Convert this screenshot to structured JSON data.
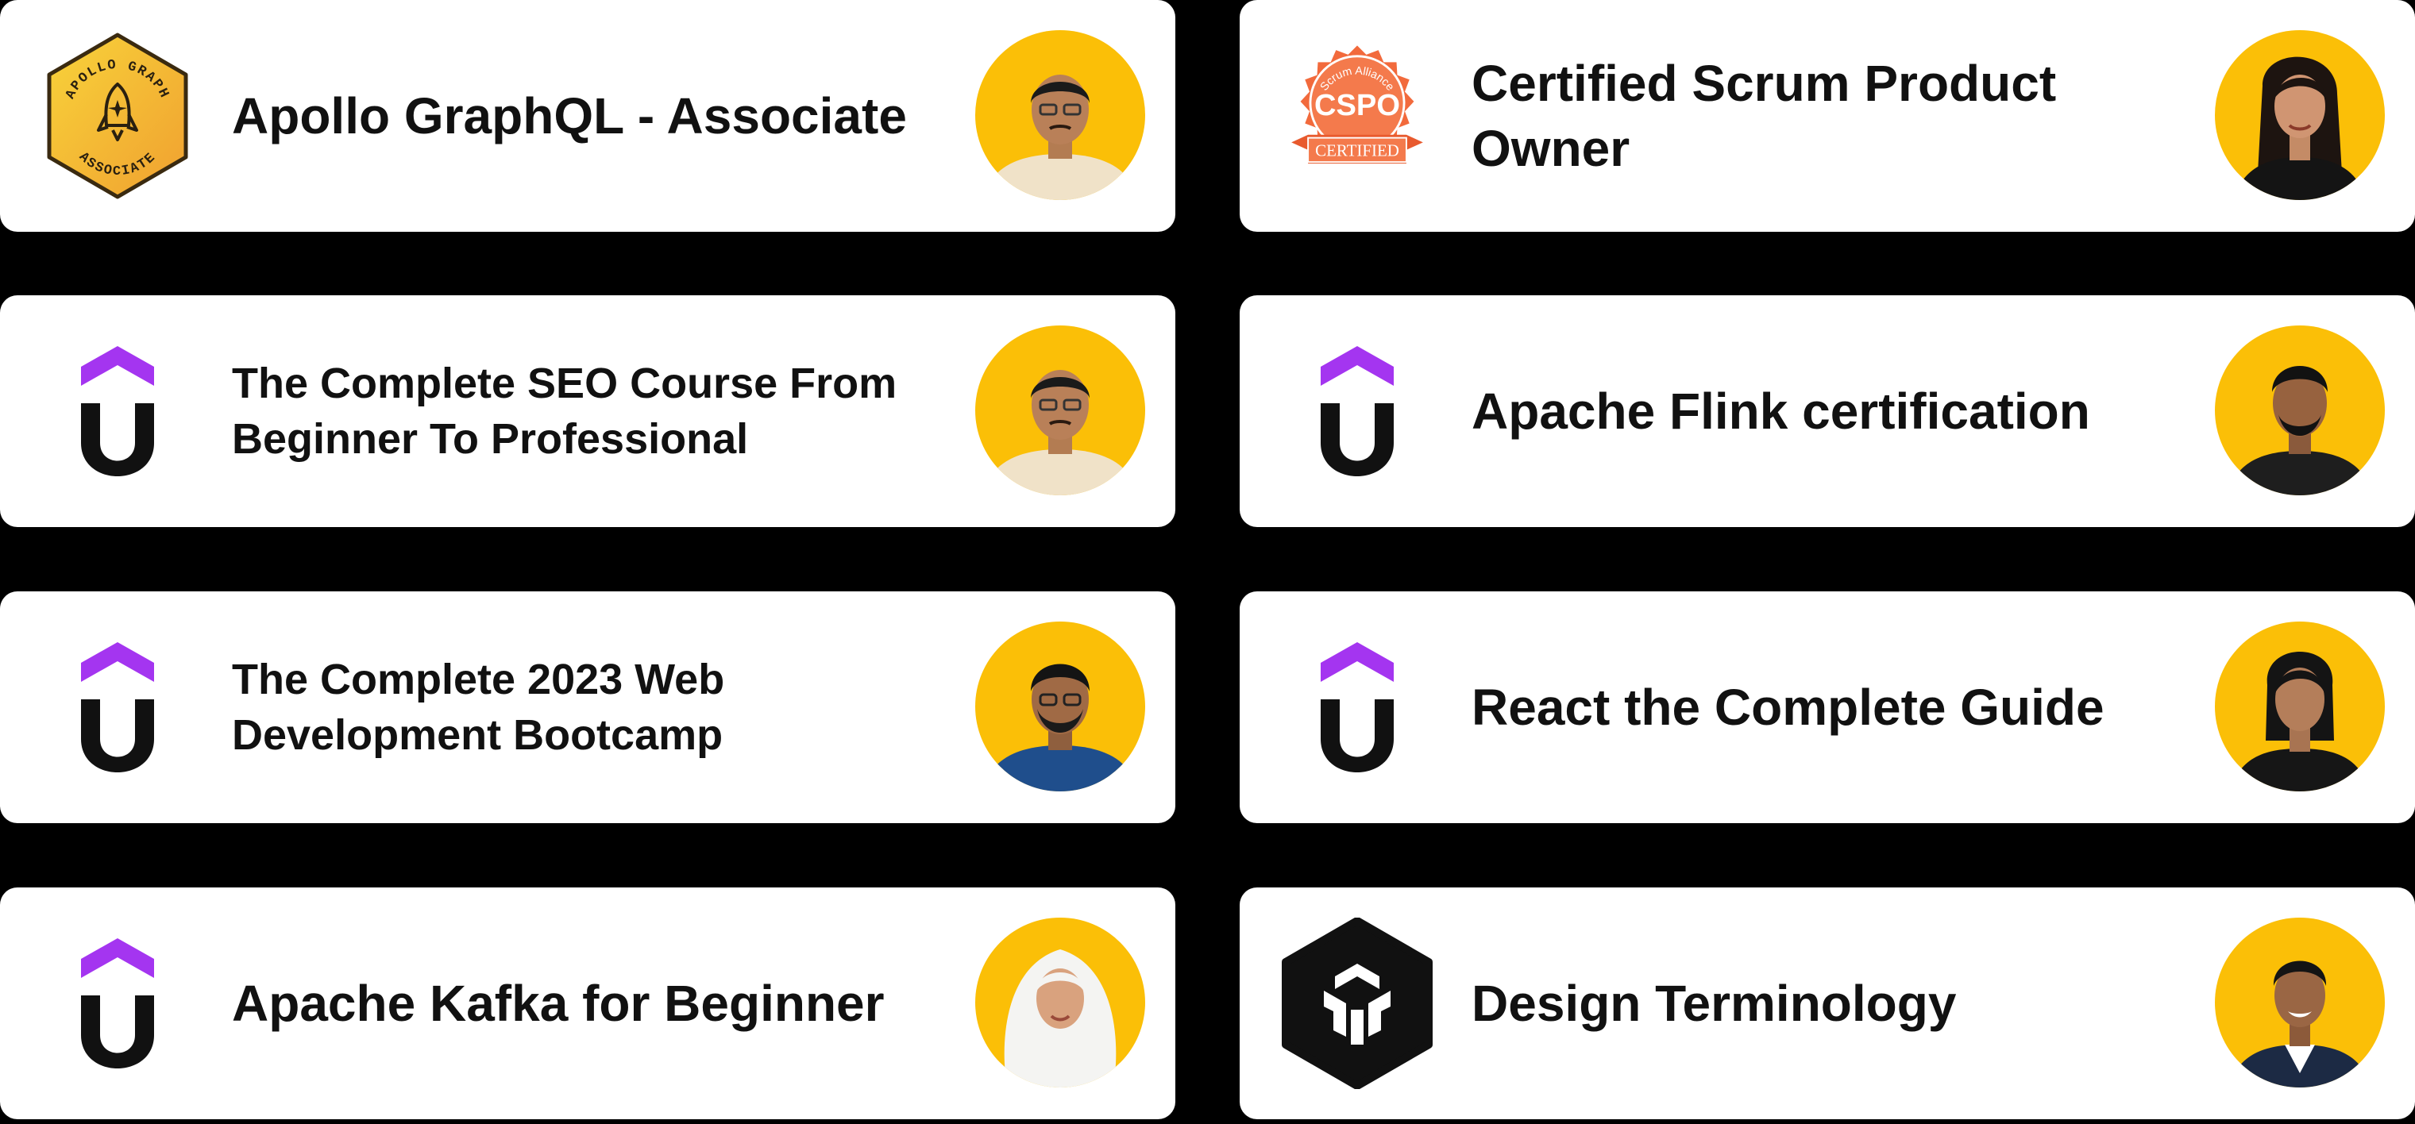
{
  "colors": {
    "background": "#000000",
    "card": "#ffffff",
    "avatar_bg": "#fbbf07",
    "udemy_purple": "#a435f0",
    "text": "#111111"
  },
  "cards": [
    {
      "title": "Apollo GraphQL - Associate",
      "logo": "apollo-graph-associate-badge",
      "badge_top": "APOLLO GRAPH",
      "badge_bottom": "ASSOCIATE",
      "avatar": "person-avatar"
    },
    {
      "title": "Certified Scrum Product Owner",
      "logo": "cspo-certified-seal",
      "seal_top": "Scrum Alliance",
      "seal_main": "CSPO",
      "seal_ribbon": "CERTIFIED",
      "avatar": "person-avatar"
    },
    {
      "title": "The Complete SEO Course From Beginner To Professional",
      "logo": "udemy-logo",
      "avatar": "person-avatar"
    },
    {
      "title": "Apache Flink certification",
      "logo": "udemy-logo",
      "avatar": "person-avatar"
    },
    {
      "title": "The Complete 2023 Web Development Bootcamp",
      "logo": "udemy-logo",
      "avatar": "person-avatar"
    },
    {
      "title": "React the Complete Guide",
      "logo": "udemy-logo",
      "avatar": "person-avatar"
    },
    {
      "title": "Apache Kafka for Beginner",
      "logo": "udemy-logo",
      "avatar": "person-avatar"
    },
    {
      "title": "Design Terminology",
      "logo": "design-terminology-logo",
      "avatar": "person-avatar"
    }
  ]
}
